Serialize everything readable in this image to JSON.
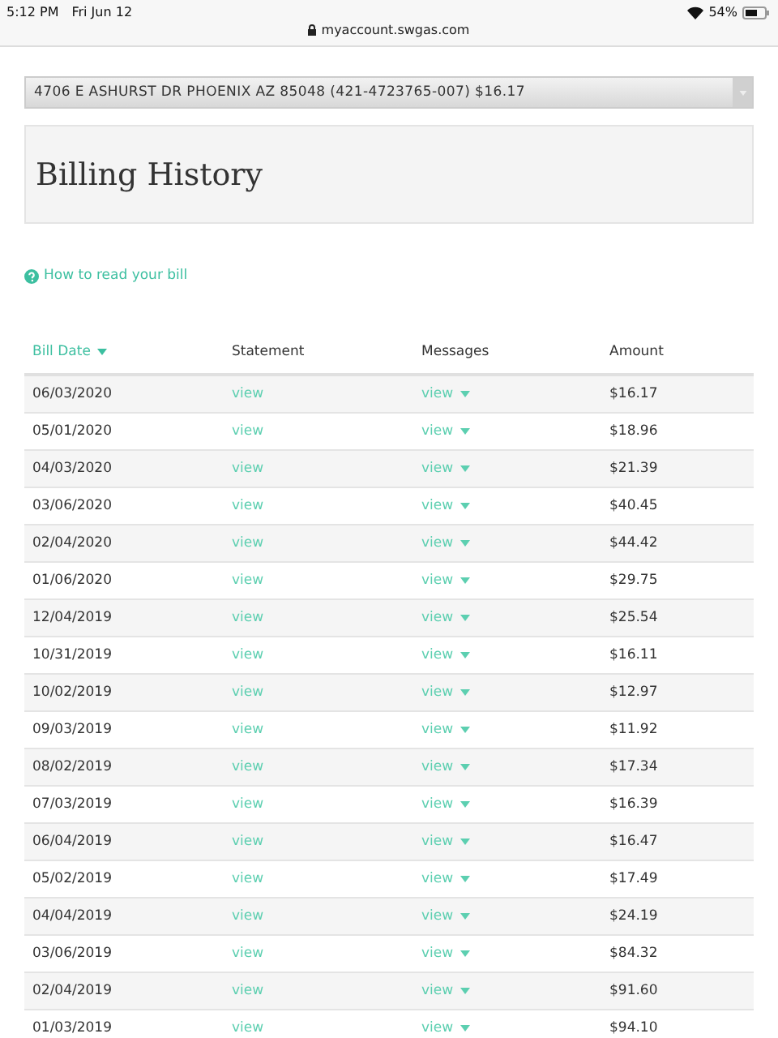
{
  "status_bar": {
    "time": "5:12 PM",
    "date": "Fri Jun 12",
    "battery_text": "54%"
  },
  "browser": {
    "url": "myaccount.swgas.com"
  },
  "account_select": {
    "value": "4706 E ASHURST DR PHOENIX AZ 85048 (421-4723765-007) $16.17"
  },
  "page_title": "Billing History",
  "help_link": "How to read your bill",
  "table": {
    "columns": [
      {
        "label": "Bill Date",
        "sortable": true
      },
      {
        "label": "Statement",
        "sortable": false
      },
      {
        "label": "Messages",
        "sortable": false
      },
      {
        "label": "Amount",
        "sortable": false
      }
    ],
    "rows": [
      {
        "date": "06/03/2020",
        "statement": "view",
        "messages": "view",
        "amount": "$16.17"
      },
      {
        "date": "05/01/2020",
        "statement": "view",
        "messages": "view",
        "amount": "$18.96"
      },
      {
        "date": "04/03/2020",
        "statement": "view",
        "messages": "view",
        "amount": "$21.39"
      },
      {
        "date": "03/06/2020",
        "statement": "view",
        "messages": "view",
        "amount": "$40.45"
      },
      {
        "date": "02/04/2020",
        "statement": "view",
        "messages": "view",
        "amount": "$44.42"
      },
      {
        "date": "01/06/2020",
        "statement": "view",
        "messages": "view",
        "amount": "$29.75"
      },
      {
        "date": "12/04/2019",
        "statement": "view",
        "messages": "view",
        "amount": "$25.54"
      },
      {
        "date": "10/31/2019",
        "statement": "view",
        "messages": "view",
        "amount": "$16.11"
      },
      {
        "date": "10/02/2019",
        "statement": "view",
        "messages": "view",
        "amount": "$12.97"
      },
      {
        "date": "09/03/2019",
        "statement": "view",
        "messages": "view",
        "amount": "$11.92"
      },
      {
        "date": "08/02/2019",
        "statement": "view",
        "messages": "view",
        "amount": "$17.34"
      },
      {
        "date": "07/03/2019",
        "statement": "view",
        "messages": "view",
        "amount": "$16.39"
      },
      {
        "date": "06/04/2019",
        "statement": "view",
        "messages": "view",
        "amount": "$16.47"
      },
      {
        "date": "05/02/2019",
        "statement": "view",
        "messages": "view",
        "amount": "$17.49"
      },
      {
        "date": "04/04/2019",
        "statement": "view",
        "messages": "view",
        "amount": "$24.19"
      },
      {
        "date": "03/06/2019",
        "statement": "view",
        "messages": "view",
        "amount": "$84.32"
      },
      {
        "date": "02/04/2019",
        "statement": "view",
        "messages": "view",
        "amount": "$91.60"
      },
      {
        "date": "01/03/2019",
        "statement": "view",
        "messages": "view",
        "amount": "$94.10"
      }
    ]
  }
}
